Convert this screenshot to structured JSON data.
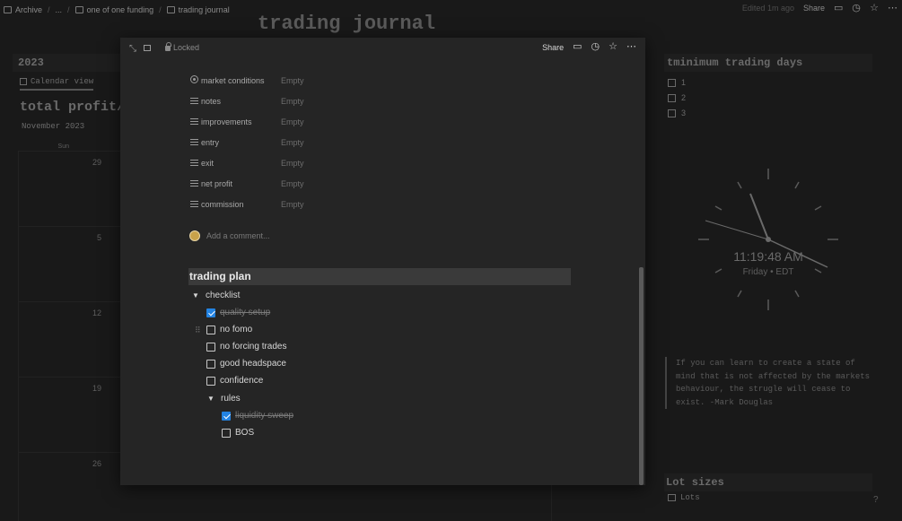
{
  "topbar": {
    "breadcrumbs": [
      "Archive",
      "...",
      "one of one funding",
      "trading journal"
    ],
    "edited": "Edited 1m ago",
    "share": "Share"
  },
  "background": {
    "page_title": "trading journal",
    "year_header": "2023",
    "calendar_view_tab": "Calendar view",
    "profit_heading": "total profit/l",
    "month_label": "November 2023",
    "weekday": "Sun",
    "calendar_dates": [
      "29",
      "5",
      "12",
      "19",
      "26"
    ],
    "min_days_header": "tminimum trading days",
    "min_days_items": [
      "1",
      "2",
      "3"
    ],
    "clock_time": "11:19:48 AM",
    "clock_day": "Friday • EDT",
    "quote": "If you can learn to create a state of mind that is not affected by the markets behaviour, the strugle will cease to exist. -Mark Douglas",
    "lot_sizes_header": "Lot sizes",
    "lot_sizes_item": "Lots",
    "help": "?"
  },
  "modal": {
    "lock_label": "Locked",
    "share_label": "Share",
    "properties": [
      {
        "name": "market conditions",
        "value": "Empty",
        "icon": "select-icon"
      },
      {
        "name": "notes",
        "value": "Empty",
        "icon": "text-icon"
      },
      {
        "name": "improvements",
        "value": "Empty",
        "icon": "text-icon"
      },
      {
        "name": "entry",
        "value": "Empty",
        "icon": "text-icon"
      },
      {
        "name": "exit",
        "value": "Empty",
        "icon": "text-icon"
      },
      {
        "name": "net profit",
        "value": "Empty",
        "icon": "text-icon"
      },
      {
        "name": "commission",
        "value": "Empty",
        "icon": "text-icon"
      }
    ],
    "comment_placeholder": "Add a comment...",
    "plan_heading": "trading plan",
    "checklist_label": "checklist",
    "checklist": [
      {
        "label": "quality setup",
        "checked": true
      },
      {
        "label": "no fomo",
        "checked": false
      },
      {
        "label": "no forcing trades",
        "checked": false
      },
      {
        "label": "good headspace",
        "checked": false
      },
      {
        "label": "confidence",
        "checked": false
      }
    ],
    "rules_label": "rules",
    "rules": [
      {
        "label": "liquidity sweep",
        "checked": true
      },
      {
        "label": "BOS",
        "checked": false
      }
    ]
  },
  "colors": {
    "accent": "#2383e2",
    "modal_bg": "#252525",
    "page_bg": "#191919"
  }
}
